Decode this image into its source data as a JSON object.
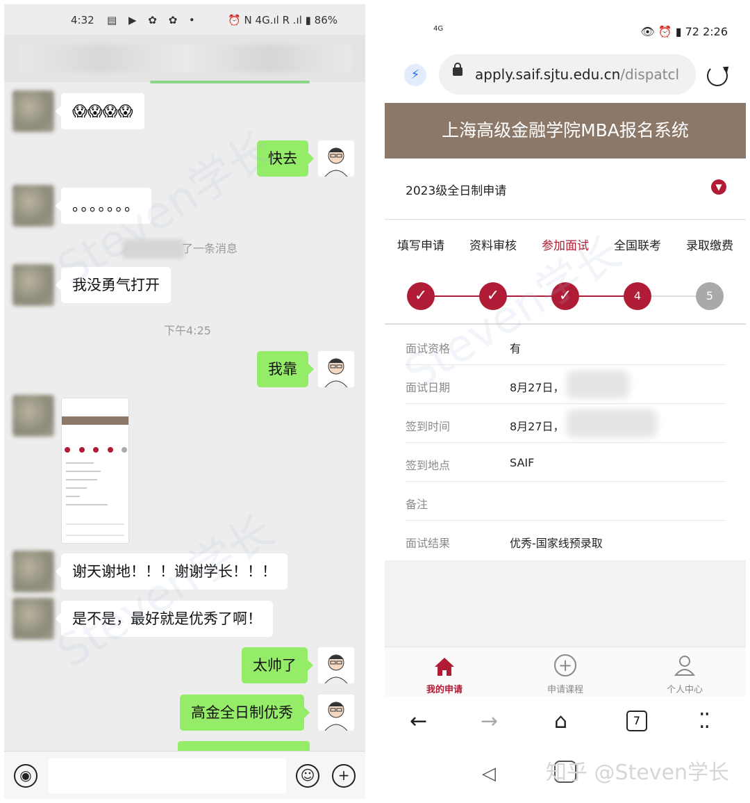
{
  "left": {
    "status_bar": {
      "time": "4:32",
      "icons": "▤ ▶ ✿ ✿ •",
      "right": "⏰ N 4G.ıl R .ıl ▮ 86%"
    },
    "messages": [
      {
        "side": "in",
        "text": "😱😱😱😱"
      },
      {
        "side": "out",
        "text": "快去"
      },
      {
        "side": "in",
        "text": "。。。。。。。"
      },
      {
        "side": "in",
        "text": "我没勇气打开"
      },
      {
        "side": "out",
        "text": "我靠"
      },
      {
        "side": "in",
        "text": "谢天谢地！！！谢谢学长！！！"
      },
      {
        "side": "in",
        "text": "是不是，最好就是优秀了啊！"
      },
      {
        "side": "out",
        "text": "太帅了"
      },
      {
        "side": "out",
        "text": "高金全日制优秀"
      }
    ],
    "system_msg": "了一条消息",
    "timestamp": "下午4:25"
  },
  "right": {
    "status_bar": {
      "signal": "4G",
      "right": "👁 ⏰ ▮ 72 2:26",
      "battery": "72",
      "time": "2:26"
    },
    "url": {
      "domain": "apply.saif.sjtu.edu.cn",
      "path": "/dispatcl"
    },
    "site_title": "上海高级金融学院MBA报名系统",
    "term": "2023级全日制申请",
    "steps": [
      {
        "label": "填写申请",
        "mark": "✓",
        "state": "done"
      },
      {
        "label": "资料审核",
        "mark": "✓",
        "state": "done"
      },
      {
        "label": "参加面试",
        "mark": "✓",
        "state": "done"
      },
      {
        "label": "全国联考",
        "mark": "4",
        "state": "current"
      },
      {
        "label": "录取缴费",
        "mark": "5",
        "state": "todo"
      }
    ],
    "info": [
      {
        "key": "面试资格",
        "value": "有"
      },
      {
        "key": "面试日期",
        "value": "8月27日，"
      },
      {
        "key": "签到时间",
        "value": "8月27日，"
      },
      {
        "key": "签到地点",
        "value": "SAIF"
      },
      {
        "key": "备注",
        "value": ""
      },
      {
        "key": "面试结果",
        "value": "优秀-国家线预录取"
      }
    ],
    "tabbar": [
      {
        "label": "我的申请",
        "icon": "home-icon",
        "active": true
      },
      {
        "label": "申请课程",
        "icon": "plus-circle-icon",
        "active": false
      },
      {
        "label": "个人中心",
        "icon": "user-icon",
        "active": false
      }
    ],
    "tabs_count": "7"
  },
  "watermark": "知乎 @Steven学长",
  "colors": {
    "accent": "#b01c35",
    "header_brown": "#8b7868",
    "chat_green": "#95ec69",
    "chat_bg": "#ededed"
  }
}
